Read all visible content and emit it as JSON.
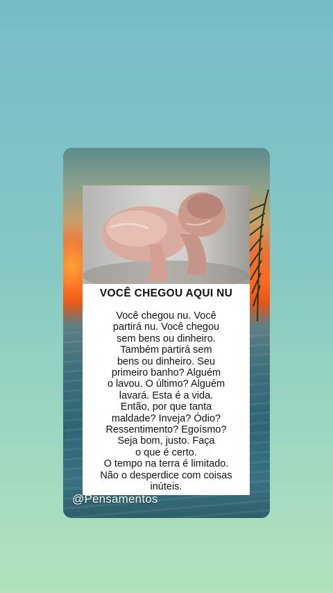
{
  "post": {
    "title": "VOCÊ CHEGOU AQUI NU",
    "lines": [
      "Você chegou nu. Você",
      "partirá nu. Você chegou",
      "sem bens ou dinheiro.",
      "Também partirá sem",
      "bens ou dinheiro. Seu",
      "primeiro banho? Alguém",
      "o lavou. O último? Alguém",
      "lavará. Esta é a vida.",
      "Então, por que tanta",
      "maldade? Inveja? Ódio?",
      "Ressentimento? Egoísmo?",
      "Seja bom, justo. Faça",
      "o que é certo.",
      "O tempo na terra é limitado.",
      "Não o desperdice com coisas",
      "inúteis."
    ]
  },
  "watermark": "@Pensamentos",
  "colors": {
    "background_top": "#76bcc8",
    "background_bottom": "#b1e3bd",
    "sunset_orange": "#ff6a1e",
    "sea": "#3c6f7b",
    "text": "#111111"
  }
}
